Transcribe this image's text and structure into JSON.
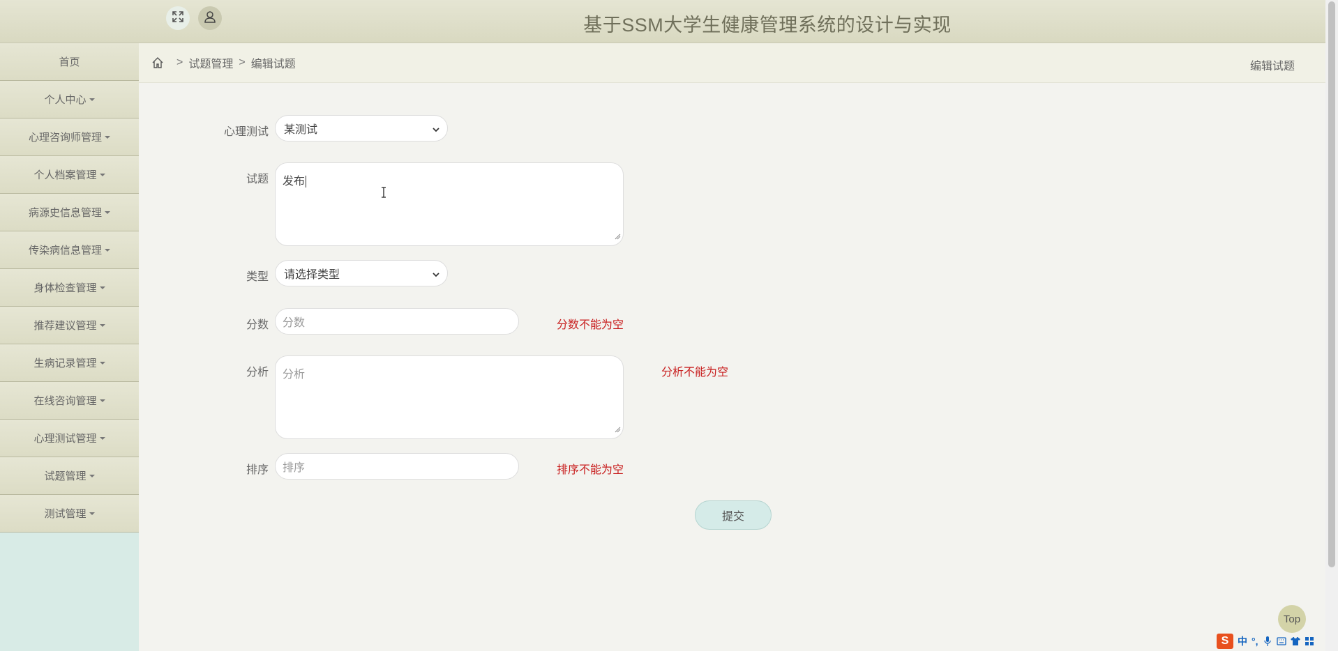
{
  "header": {
    "title": "基于SSM大学生健康管理系统的设计与实现",
    "expand_icon": "fullscreen-icon",
    "user_icon": "user-icon"
  },
  "sidebar": {
    "items": [
      {
        "label": "首页",
        "dropdown": false
      },
      {
        "label": "个人中心",
        "dropdown": true
      },
      {
        "label": "心理咨询师管理",
        "dropdown": true
      },
      {
        "label": "个人档案管理",
        "dropdown": true
      },
      {
        "label": "病源史信息管理",
        "dropdown": true
      },
      {
        "label": "传染病信息管理",
        "dropdown": true
      },
      {
        "label": "身体检查管理",
        "dropdown": true
      },
      {
        "label": "推荐建议管理",
        "dropdown": true
      },
      {
        "label": "生病记录管理",
        "dropdown": true
      },
      {
        "label": "在线咨询管理",
        "dropdown": true
      },
      {
        "label": "心理测试管理",
        "dropdown": true
      },
      {
        "label": "试题管理",
        "dropdown": true
      },
      {
        "label": "测试管理",
        "dropdown": true
      }
    ]
  },
  "breadcrumb": {
    "sep": ">",
    "items": [
      "试题管理",
      "编辑试题"
    ],
    "right_title": "编辑试题"
  },
  "form": {
    "test": {
      "label": "心理测试",
      "value": "某测试"
    },
    "question": {
      "label": "试题",
      "value": "发布"
    },
    "type": {
      "label": "类型",
      "value": "请选择类型"
    },
    "score": {
      "label": "分数",
      "placeholder": "分数",
      "error": "分数不能为空"
    },
    "analysis": {
      "label": "分析",
      "placeholder": "分析",
      "error": "分析不能为空"
    },
    "sort": {
      "label": "排序",
      "placeholder": "排序",
      "error": "排序不能为空"
    },
    "submit_label": "提交"
  },
  "top_button": "Top",
  "ime": {
    "lang": "中",
    "punct": "°,"
  },
  "colors": {
    "error": "#c81e1e",
    "header_title": "#6f6f5a",
    "sidebar_bg": "#d8ebe6"
  }
}
